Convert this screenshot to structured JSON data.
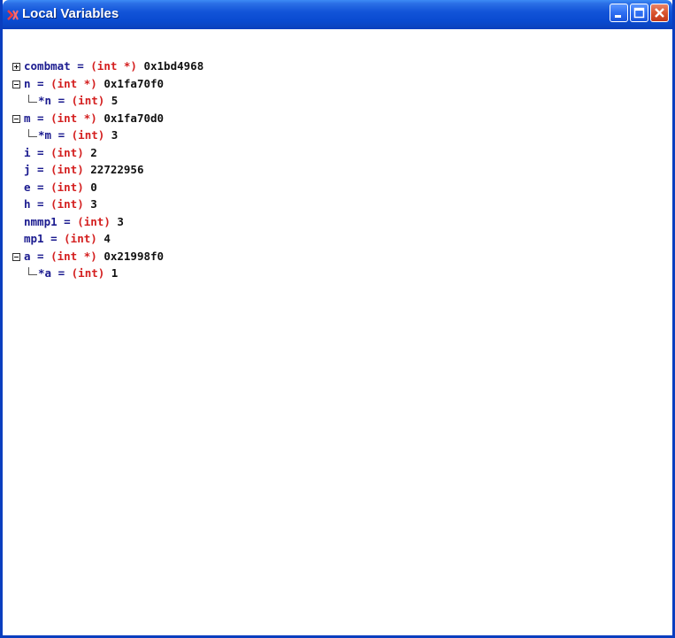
{
  "window": {
    "title": "Local Variables"
  },
  "titlebar_buttons": {
    "minimize": "minimize-button",
    "maximize": "maximize-button",
    "close": "close-button"
  },
  "variables": [
    {
      "name": "combmat",
      "eq": "=",
      "type": "(int *)",
      "value": "0x1bd4968",
      "expander": "plus"
    },
    {
      "name": "n",
      "eq": "=",
      "type": "(int *)",
      "value": "0x1fa70f0",
      "expander": "minus"
    },
    {
      "name": "*n",
      "eq": "=",
      "type": "(int)",
      "value": "5",
      "child": true
    },
    {
      "name": "m",
      "eq": "=",
      "type": "(int *)",
      "value": "0x1fa70d0",
      "expander": "minus"
    },
    {
      "name": "*m",
      "eq": "=",
      "type": "(int)",
      "value": "3",
      "child": true
    },
    {
      "name": "i",
      "eq": "=",
      "type": "(int)",
      "value": "2"
    },
    {
      "name": "j",
      "eq": "=",
      "type": "(int)",
      "value": "22722956"
    },
    {
      "name": "e",
      "eq": "=",
      "type": "(int)",
      "value": "0"
    },
    {
      "name": "h",
      "eq": "=",
      "type": "(int)",
      "value": "3"
    },
    {
      "name": "nmmp1",
      "eq": "=",
      "type": "(int)",
      "value": "3"
    },
    {
      "name": "mp1",
      "eq": "=",
      "type": "(int)",
      "value": "4"
    },
    {
      "name": "a",
      "eq": "=",
      "type": "(int *)",
      "value": "0x21998f0",
      "expander": "minus"
    },
    {
      "name": "*a",
      "eq": "=",
      "type": "(int)",
      "value": "1",
      "child": true
    }
  ],
  "colors": {
    "titlebar": "#0a4bd1",
    "name": "#1b1b8f",
    "type": "#d42020",
    "value": "#111111"
  }
}
